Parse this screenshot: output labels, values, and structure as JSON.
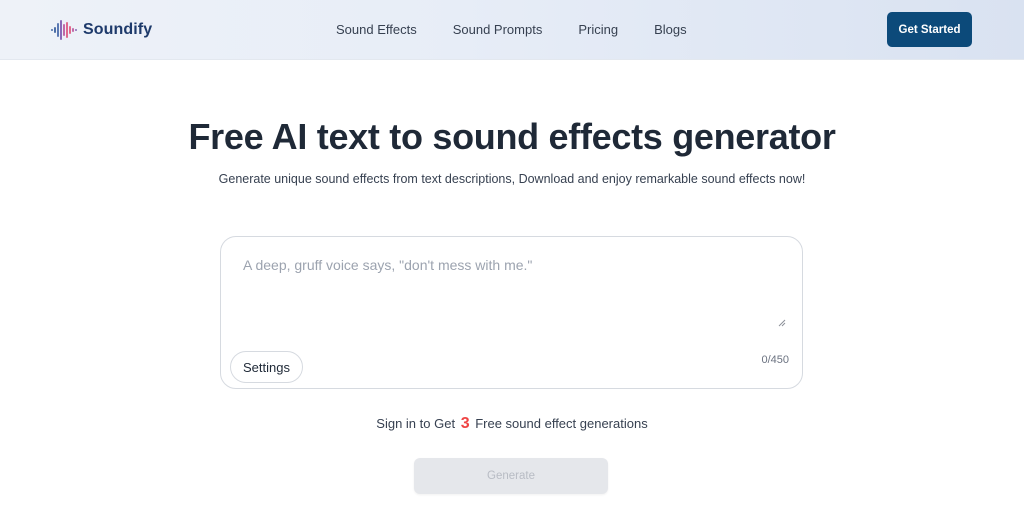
{
  "header": {
    "brand": "Soundify",
    "nav": [
      "Sound Effects",
      "Sound Prompts",
      "Pricing",
      "Blogs"
    ],
    "cta_label": "Get Started"
  },
  "hero": {
    "title": "Free AI text to sound effects generator",
    "subtitle": "Generate unique sound effects from text descriptions, Download and enjoy remarkable sound effects now!"
  },
  "prompt": {
    "placeholder": "A deep, gruff voice says, \"don't mess with me.\"",
    "value": "",
    "char_count": "0/450",
    "settings_label": "Settings"
  },
  "signin": {
    "prefix": "Sign in to Get",
    "count": "3",
    "suffix": "Free sound effect generations"
  },
  "generate_label": "Generate",
  "colors": {
    "brand": "#1e3a6b",
    "cta_bg": "#0c4a7a",
    "accent_red": "#ef4444",
    "disabled_bg": "#e5e7eb"
  },
  "icons": {
    "logo": "waveform-icon"
  }
}
